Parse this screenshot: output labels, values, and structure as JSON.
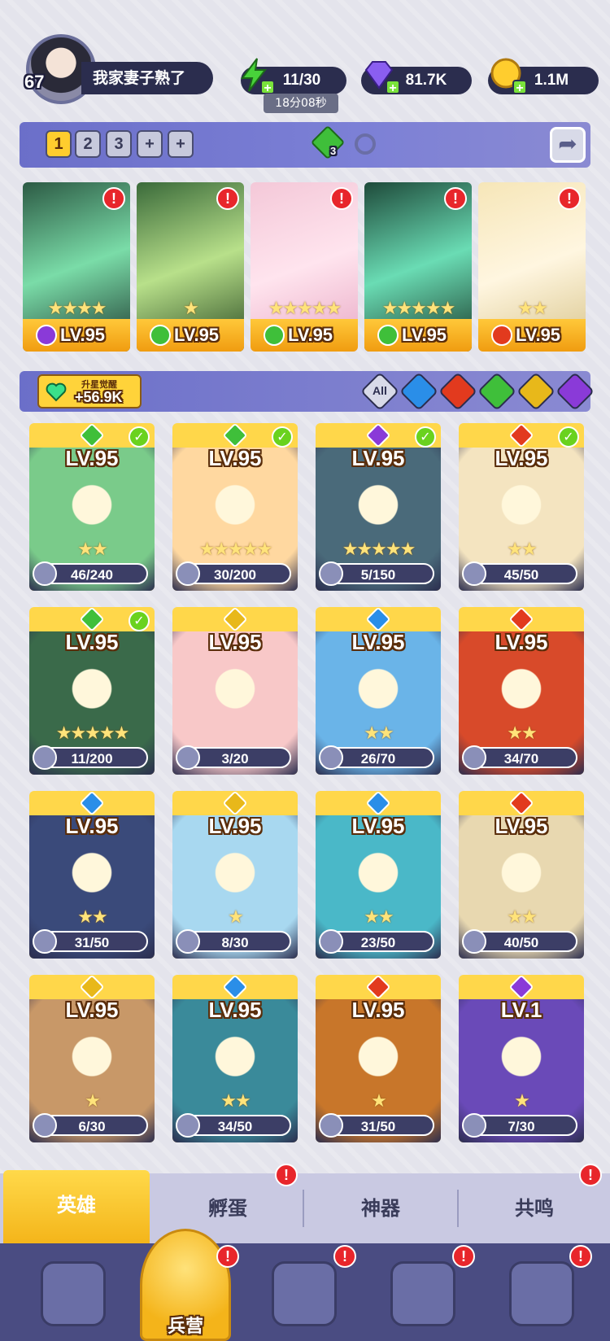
{
  "player": {
    "level": "67",
    "name": "我家妻子熟了",
    "avatar_icon": "player-avatar"
  },
  "resources": {
    "energy": {
      "value": "11/30",
      "timer": "18分08秒",
      "icon": "lightning-icon"
    },
    "gems": {
      "value": "81.7K",
      "icon": "diamond-icon"
    },
    "coins": {
      "value": "1.1M",
      "icon": "coin-icon"
    },
    "plus_label": "+"
  },
  "team_bar": {
    "tabs": [
      "1",
      "2",
      "3",
      "+",
      "+"
    ],
    "active_tab": "1",
    "element_count": "3",
    "share_icon": "share-icon"
  },
  "team": [
    {
      "level": "LV.95",
      "stars": "★★★★",
      "element": "dark",
      "alert": true
    },
    {
      "level": "LV.95",
      "stars": "★",
      "element": "wind",
      "alert": true
    },
    {
      "level": "LV.95",
      "stars": "★★★★★",
      "element": "wind",
      "alert": true
    },
    {
      "level": "LV.95",
      "stars": "★★★★★",
      "element": "wind",
      "alert": true
    },
    {
      "level": "LV.95",
      "stars": "★★",
      "element": "fire",
      "alert": true
    }
  ],
  "filter_bar": {
    "awaken_title": "升星觉醒",
    "awaken_value": "+56.9K",
    "all_label": "All",
    "filters": [
      "water",
      "fire",
      "wind",
      "light",
      "dark"
    ]
  },
  "heroes": [
    {
      "level": "LV.95",
      "stars": "★★",
      "progress": "46/240",
      "element": "wind",
      "check": true
    },
    {
      "level": "LV.95",
      "stars": "★★★★★",
      "progress": "30/200",
      "element": "wind",
      "check": true
    },
    {
      "level": "LV.95",
      "stars": "★★★★★",
      "progress": "5/150",
      "element": "dark",
      "check": true
    },
    {
      "level": "LV.95",
      "stars": "★★",
      "progress": "45/50",
      "element": "fire",
      "check": true
    },
    {
      "level": "LV.95",
      "stars": "★★★★★",
      "progress": "11/200",
      "element": "wind",
      "check": true
    },
    {
      "level": "LV.95",
      "stars": "",
      "progress": "3/20",
      "element": "light",
      "check": false
    },
    {
      "level": "LV.95",
      "stars": "★★",
      "progress": "26/70",
      "element": "water",
      "check": false
    },
    {
      "level": "LV.95",
      "stars": "★★",
      "progress": "34/70",
      "element": "fire",
      "check": false
    },
    {
      "level": "LV.95",
      "stars": "★★",
      "progress": "31/50",
      "element": "water",
      "check": false
    },
    {
      "level": "LV.95",
      "stars": "★",
      "progress": "8/30",
      "element": "light",
      "check": false
    },
    {
      "level": "LV.95",
      "stars": "★★",
      "progress": "23/50",
      "element": "water",
      "check": false
    },
    {
      "level": "LV.95",
      "stars": "★★",
      "progress": "40/50",
      "element": "fire",
      "check": false
    },
    {
      "level": "LV.95",
      "stars": "★",
      "progress": "6/30",
      "element": "light",
      "check": false
    },
    {
      "level": "LV.95",
      "stars": "★★",
      "progress": "34/50",
      "element": "water",
      "check": false
    },
    {
      "level": "LV.95",
      "stars": "★",
      "progress": "31/50",
      "element": "fire",
      "check": false
    },
    {
      "level": "LV.1",
      "stars": "★",
      "progress": "7/30",
      "element": "dark",
      "check": false
    }
  ],
  "tabs": [
    {
      "label": "英雄",
      "active": true,
      "alert": false
    },
    {
      "label": "孵蛋",
      "active": false,
      "alert": true
    },
    {
      "label": "神器",
      "active": false,
      "alert": false
    },
    {
      "label": "共鸣",
      "active": false,
      "alert": true
    }
  ],
  "bottom_nav": {
    "items": [
      {
        "icon": "cards-icon",
        "alert": false
      },
      {
        "icon": "map-icon",
        "alert": true
      },
      {
        "icon": "shop-icon",
        "alert": true
      },
      {
        "icon": "mushroom-icon",
        "alert": true
      }
    ],
    "barracks_label": "兵营"
  },
  "colors": {
    "accent": "#ffcd2e",
    "alert": "#e8262b",
    "panel": "#2b2d4e",
    "element_wind": "#3fbf3a",
    "element_fire": "#e23a1e",
    "element_water": "#2a8ee8",
    "element_light": "#e8b81a",
    "element_dark": "#8a3ad8"
  }
}
